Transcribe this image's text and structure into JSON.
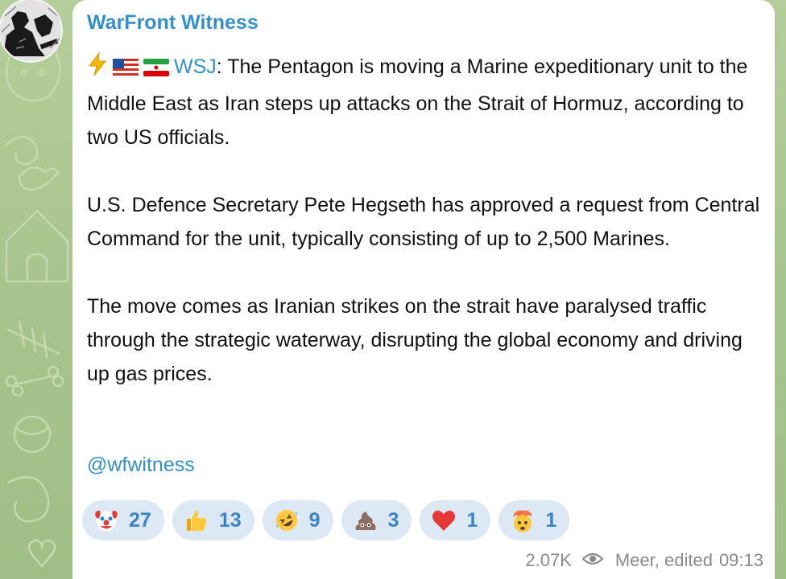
{
  "channel": {
    "name": "WarFront Witness"
  },
  "post": {
    "lead_flags": [
      "high-voltage-emoji",
      "us-flag-emoji",
      "iran-flag-emoji"
    ],
    "source": "WSJ",
    "p1_rest": ": The Pentagon is moving a Marine expeditionary unit to the Middle East as Iran steps up attacks on the Strait of Hormuz, according to two US officials.",
    "p2": "U.S. Defence Secretary Pete Hegseth has approved a request from Central Command for the unit, typically consisting of up to 2,500 Marines.",
    "p3": "The move comes as Iranian strikes on the strait have paralysed traffic through the strategic waterway, disrupting the global economy and driving up gas prices.",
    "mention": "@wfwitness"
  },
  "reactions": [
    {
      "emoji": "clown-face-emoji",
      "count": "27"
    },
    {
      "emoji": "thumbs-up-emoji",
      "count": "13"
    },
    {
      "emoji": "rolling-laughing-emoji",
      "count": "9"
    },
    {
      "emoji": "pile-of-poo-emoji",
      "count": "3"
    },
    {
      "emoji": "red-heart-emoji",
      "count": "1"
    },
    {
      "emoji": "exploding-head-emoji",
      "count": "1"
    }
  ],
  "meta": {
    "views": "2.07K",
    "views_icon": "eye-icon",
    "author": "Meer, edited",
    "time": "09:13"
  },
  "colors": {
    "accent": "#3390c8",
    "reaction_bg": "#dde8f5",
    "reaction_text": "#3a84c4",
    "wallpaper": "#a9c493",
    "meta_text": "#8a8a8a"
  }
}
